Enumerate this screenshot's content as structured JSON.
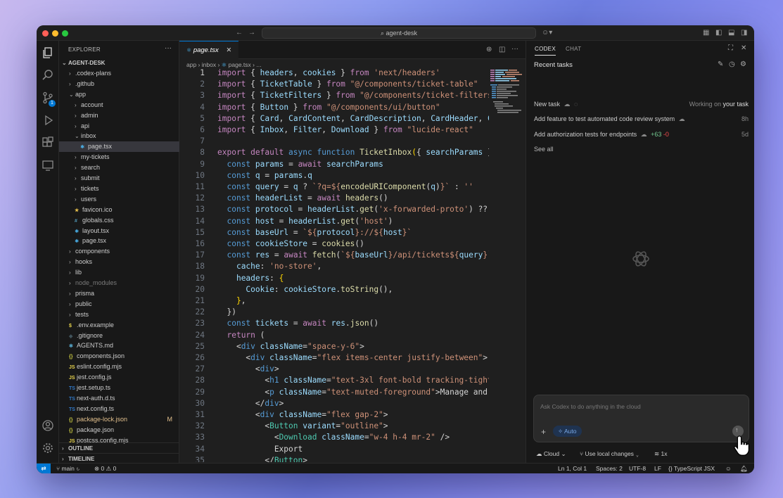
{
  "titlebar": {
    "search_text": "agent-desk"
  },
  "explorer": {
    "header": "EXPLORER",
    "more": "···",
    "root": "AGENT-DESK",
    "outline": "OUTLINE",
    "timeline": "TIMELINE",
    "items": [
      {
        "label": ".codex-plans",
        "type": "folder",
        "indent": 1,
        "open": false
      },
      {
        "label": ".github",
        "type": "folder",
        "indent": 1,
        "open": false
      },
      {
        "label": "app",
        "type": "folder",
        "indent": 1,
        "open": true
      },
      {
        "label": "account",
        "type": "folder",
        "indent": 2,
        "open": false
      },
      {
        "label": "admin",
        "type": "folder",
        "indent": 2,
        "open": false
      },
      {
        "label": "api",
        "type": "folder",
        "indent": 2,
        "open": false
      },
      {
        "label": "inbox",
        "type": "folder",
        "indent": 2,
        "open": true
      },
      {
        "label": "page.tsx",
        "type": "tsx",
        "indent": 3,
        "selected": true
      },
      {
        "label": "my-tickets",
        "type": "folder",
        "indent": 2,
        "open": false
      },
      {
        "label": "search",
        "type": "folder",
        "indent": 2,
        "open": false
      },
      {
        "label": "submit",
        "type": "folder",
        "indent": 2,
        "open": false
      },
      {
        "label": "tickets",
        "type": "folder",
        "indent": 2,
        "open": false
      },
      {
        "label": "users",
        "type": "folder",
        "indent": 2,
        "open": false
      },
      {
        "label": "favicon.ico",
        "type": "ico",
        "indent": 2
      },
      {
        "label": "globals.css",
        "type": "css",
        "indent": 2
      },
      {
        "label": "layout.tsx",
        "type": "tsx",
        "indent": 2
      },
      {
        "label": "page.tsx",
        "type": "tsx",
        "indent": 2
      },
      {
        "label": "components",
        "type": "folder",
        "indent": 1,
        "open": false
      },
      {
        "label": "hooks",
        "type": "folder",
        "indent": 1,
        "open": false
      },
      {
        "label": "lib",
        "type": "folder",
        "indent": 1,
        "open": false
      },
      {
        "label": "node_modules",
        "type": "folder",
        "indent": 1,
        "open": false,
        "dim": true
      },
      {
        "label": "prisma",
        "type": "folder",
        "indent": 1,
        "open": false
      },
      {
        "label": "public",
        "type": "folder",
        "indent": 1,
        "open": false
      },
      {
        "label": "tests",
        "type": "folder",
        "indent": 1,
        "open": false
      },
      {
        "label": ".env.example",
        "type": "env",
        "indent": 1
      },
      {
        "label": ".gitignore",
        "type": "git",
        "indent": 1
      },
      {
        "label": "AGENTS.md",
        "type": "md",
        "indent": 1
      },
      {
        "label": "components.json",
        "type": "json",
        "indent": 1
      },
      {
        "label": "eslint.config.mjs",
        "type": "js",
        "indent": 1
      },
      {
        "label": "jest.config.js",
        "type": "js",
        "indent": 1
      },
      {
        "label": "jest.setup.ts",
        "type": "ts",
        "indent": 1
      },
      {
        "label": "next-auth.d.ts",
        "type": "ts",
        "indent": 1
      },
      {
        "label": "next.config.ts",
        "type": "ts",
        "indent": 1
      },
      {
        "label": "package-lock.json",
        "type": "json",
        "indent": 1,
        "modified": "M",
        "warn": true
      },
      {
        "label": "package.json",
        "type": "json",
        "indent": 1
      },
      {
        "label": "postcss.config.mjs",
        "type": "js",
        "indent": 1
      }
    ]
  },
  "editor": {
    "tab_label": "page.tsx",
    "breadcrumb": [
      "app",
      "inbox",
      "page.tsx",
      "..."
    ],
    "line_numbers": [
      "1",
      "2",
      "3",
      "4",
      "5",
      "6",
      "7",
      "8",
      "9",
      "10",
      "11",
      "12",
      "13",
      "14",
      "15",
      "16",
      "17",
      "18",
      "19",
      "20",
      "21",
      "22",
      "23",
      "24",
      "25",
      "26",
      "27",
      "28",
      "29",
      "30",
      "31",
      "32",
      "33",
      "34",
      "35"
    ]
  },
  "codex": {
    "tabs": [
      "CODEX",
      "CHAT"
    ],
    "recent_title": "Recent tasks",
    "new_task": "New task",
    "working_prefix": "Working on ",
    "working_suffix": "your task",
    "tasks": [
      {
        "title": "Add feature to test automated code review system",
        "age": "8h"
      },
      {
        "title": "Add authorization tests for endpoints",
        "added": "+63",
        "removed": "-0",
        "age": "5d"
      }
    ],
    "see_all": "See all",
    "input_placeholder": "Ask Codex to do anything in the cloud",
    "auto_label": "Auto",
    "cloud_label": "Cloud",
    "local_changes_label": "Use local changes",
    "count_label": "1x"
  },
  "statusbar": {
    "branch": "main",
    "errors": "0",
    "warnings": "0",
    "position": "Ln 1, Col 1",
    "spaces": "Spaces: 2",
    "encoding": "UTF-8",
    "eol": "LF",
    "language": "TypeScript JSX"
  },
  "colors": {
    "accent": "#0078d4",
    "tsx": "#4fc1ff",
    "json": "#cbcb41",
    "js": "#e8d44d",
    "ts": "#3178c6",
    "modified": "#e2c08d"
  }
}
